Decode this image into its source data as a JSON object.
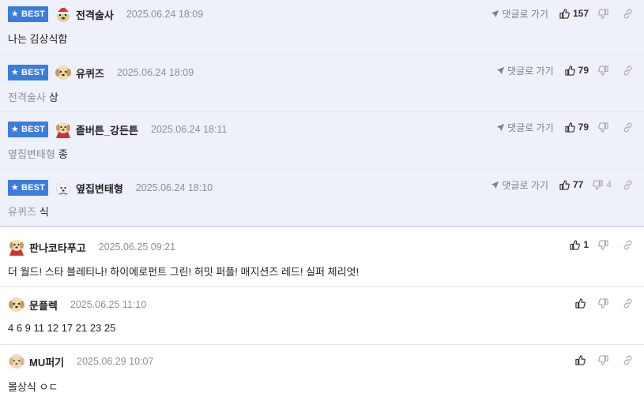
{
  "labels": {
    "best": "BEST",
    "goto_reply": "댓글로 가기"
  },
  "comments": [
    {
      "best": true,
      "avatar": "santa-dog-avatar",
      "nick": "전격술사",
      "date": "2025.06.24 18:09",
      "reply_to": "",
      "text": "나는 김상식함",
      "likes": "157",
      "dislikes": ""
    },
    {
      "best": true,
      "avatar": "puppy-avatar",
      "nick": "유퀴즈",
      "date": "2025.06.24 18:09",
      "reply_to": "전격술사",
      "text": "상",
      "likes": "79",
      "dislikes": ""
    },
    {
      "best": true,
      "avatar": "cape-dog-avatar",
      "nick": "좉버튼_강든튼",
      "date": "2025.06.24 18:11",
      "reply_to": "옆집변태형",
      "text": "종",
      "likes": "79",
      "dislikes": ""
    },
    {
      "best": true,
      "avatar": "white-dog-avatar",
      "nick": "옆집변태형",
      "date": "2025.06.24 18:10",
      "reply_to": "유퀴즈",
      "text": "식",
      "likes": "77",
      "dislikes": "4"
    },
    {
      "best": false,
      "avatar": "cape-dog-avatar",
      "nick": "판나코타푸고",
      "date": "2025.06.25 09:21",
      "reply_to": "",
      "text": "더 월드! 스타 블레티나! 하이에로펀트 그린! 허밋 퍼플! 매지션즈 레드! 실퍼 체리엇!",
      "likes": "1",
      "dislikes": ""
    },
    {
      "best": false,
      "avatar": "puppy-avatar",
      "nick": "문플렉",
      "date": "2025.06.25 11:10",
      "reply_to": "",
      "text": "4 6 9 11 12 17 21 23 25",
      "likes": "",
      "dislikes": ""
    },
    {
      "best": false,
      "avatar": "blur-puppy-avatar",
      "nick": "MU퍼기",
      "date": "2025.06.29 10:07",
      "reply_to": "",
      "text": "몰상식 ㅇㄷ",
      "likes": "",
      "dislikes": ""
    }
  ]
}
